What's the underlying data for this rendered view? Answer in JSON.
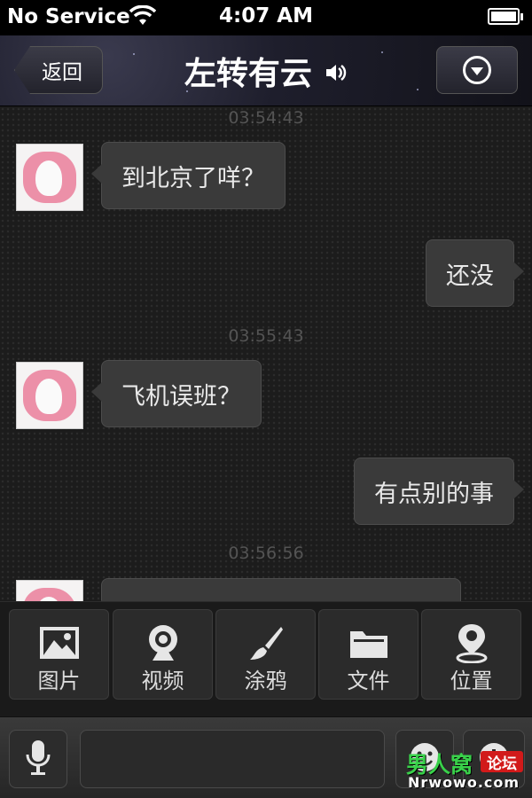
{
  "status_bar": {
    "carrier": "No Service",
    "time": "4:07 AM"
  },
  "nav": {
    "back_label": "返回",
    "title": "左转有云"
  },
  "messages": {
    "ts1": "03:54:43",
    "msg1": "到北京了咩？",
    "msg2": "还没",
    "ts2": "03:55:43",
    "msg3": "飞机误班？",
    "msg4": "有点别的事",
    "ts3": "03:56:56"
  },
  "panel": {
    "items": [
      {
        "label": "图片",
        "icon": "image-icon"
      },
      {
        "label": "视频",
        "icon": "webcam-icon"
      },
      {
        "label": "涂鸦",
        "icon": "brush-icon"
      },
      {
        "label": "文件",
        "icon": "folder-icon"
      },
      {
        "label": "位置",
        "icon": "location-icon"
      }
    ]
  },
  "input": {
    "value": ""
  },
  "watermark": {
    "main": "男人窝",
    "tag": "论坛",
    "url": "Nrwowo.com"
  }
}
